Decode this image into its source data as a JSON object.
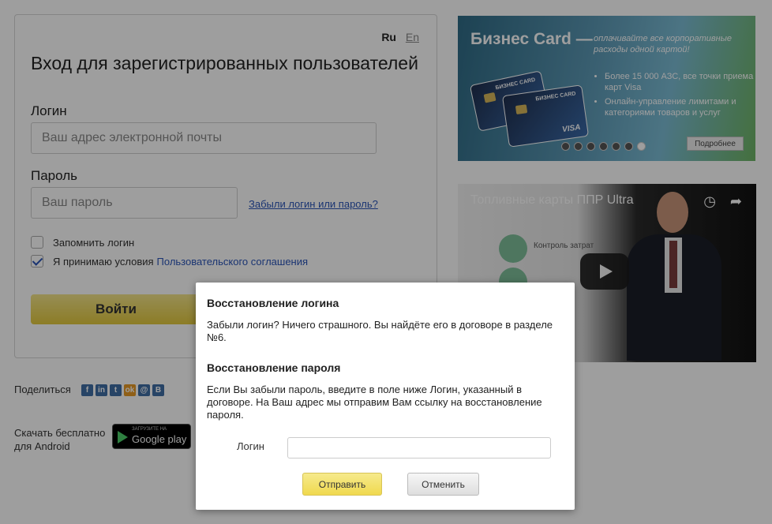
{
  "login": {
    "lang_ru": "Ru",
    "lang_en": "En",
    "title": "Вход для зарегистрированных пользователей",
    "login_label": "Логин",
    "login_placeholder": "Ваш адрес электронной почты",
    "password_label": "Пароль",
    "password_placeholder": "Ваш пароль",
    "forgot_link": "Забыли логин или пароль?",
    "remember_label": "Запомнить логин",
    "remember_checked": false,
    "accept_label": "Я принимаю условия",
    "accept_link": "Пользовательского соглашения",
    "accept_checked": true,
    "submit_label": "Войти"
  },
  "share": {
    "label": "Поделиться",
    "icons": [
      "facebook-icon",
      "linkedin-icon",
      "twitter-icon",
      "odnoklassniki-icon",
      "mail-icon",
      "vk-icon"
    ],
    "glyphs": [
      "f",
      "in",
      "t",
      "ok",
      "@",
      "B"
    ]
  },
  "android": {
    "text": "Скачать бесплатно для Android",
    "badge_small": "ЗАГРУЗИТЕ НА",
    "badge_big": "Google play"
  },
  "banner": {
    "title": "Бизнес Card —",
    "subtitle": "оплачивайте все корпоративные расходы одной картой!",
    "bullets": [
      "Более 15 000 АЗС, все точки приема карт Visa",
      "Онлайн-управление лимитами и категориями товаров и услуг"
    ],
    "card_label": "БИЗНЕС CARD",
    "card_visa": "VISA",
    "dots_count": 7,
    "active_dot": 7,
    "more_button": "Подробнее"
  },
  "video": {
    "title": "Топливные карты ППР Ultra",
    "control_text": "Контроль затрат"
  },
  "modal": {
    "login_recovery_title": "Восстановление логина",
    "login_recovery_text": "Забыли логин? Ничего страшного. Вы найдёте его в договоре в разделе №6.",
    "password_recovery_title": "Восстановление пароля",
    "password_recovery_text": "Если Вы забыли пароль, введите в поле ниже Логин, указанный в договоре. На Ваш адрес мы отправим Вам ссылку на восстановление пароля.",
    "field_label": "Логин",
    "field_value": "",
    "send_button": "Отправить",
    "cancel_button": "Отменить"
  }
}
